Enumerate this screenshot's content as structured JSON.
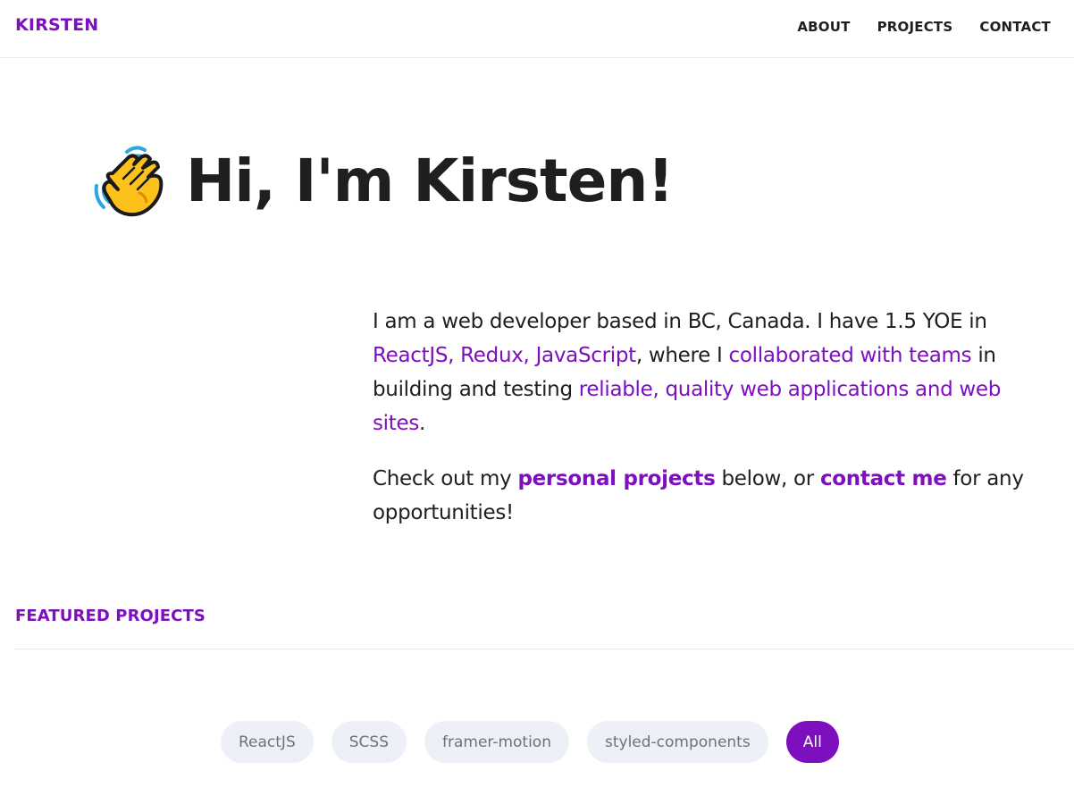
{
  "brand": "KIRSTEN",
  "nav": [
    {
      "label": "ABOUT"
    },
    {
      "label": "PROJECTS"
    },
    {
      "label": "CONTACT"
    }
  ],
  "hero": {
    "icon": "waving-hand-icon",
    "heading": "Hi, I'm Kirsten!"
  },
  "intro": {
    "p1_part1": "I am a web developer based in BC, Canada. I have 1.5 YOE in ",
    "p1_hl1": "ReactJS, Redux, JavaScript",
    "p1_part2": ", where I ",
    "p1_hl2": "collaborated with teams",
    "p1_part3": " in building and testing ",
    "p1_hl3": "reliable, quality web applications and web sites",
    "p1_part4": ".",
    "p2_part1": "Check out my ",
    "p2_link1": "personal projects",
    "p2_part2": " below, or ",
    "p2_link2": "contact me",
    "p2_part3": " for any opportunities!"
  },
  "featured": {
    "title": "FEATURED PROJECTS",
    "filters": [
      {
        "label": "ReactJS",
        "active": false
      },
      {
        "label": "SCSS",
        "active": false
      },
      {
        "label": "framer-motion",
        "active": false
      },
      {
        "label": "styled-components",
        "active": false
      },
      {
        "label": "All",
        "active": true
      }
    ]
  },
  "colors": {
    "accent": "#7d0fbe",
    "chip_bg": "#edf1f7",
    "text": "#1f1f1f"
  }
}
